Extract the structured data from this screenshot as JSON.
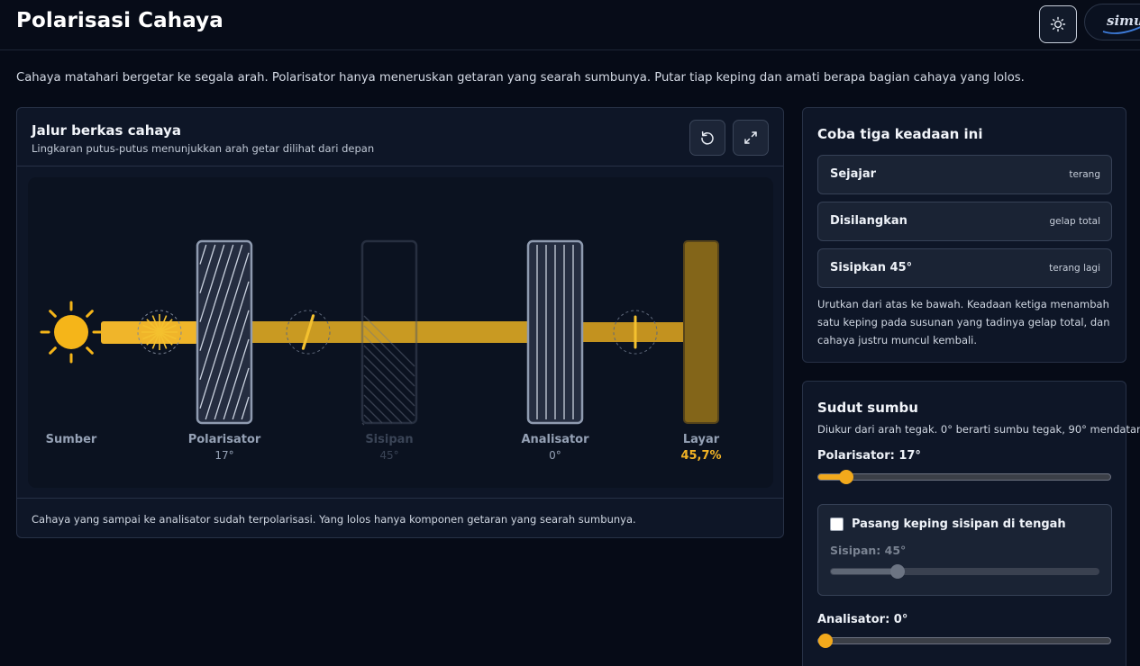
{
  "header": {
    "title": "Polarisasi Cahaya",
    "brand": "simu",
    "theme_icon": "sun-icon"
  },
  "intro": "Cahaya matahari bergetar ke segala arah. Polarisator hanya meneruskan getaran yang searah sumbunya. Putar tiap keping dan amati berapa bagian cahaya yang lolos.",
  "beam_panel": {
    "title": "Jalur berkas cahaya",
    "subtitle": "Lingkaran putus-putus menunjukkan arah getar dilihat dari depan",
    "reset_icon": "reset-icon",
    "expand_icon": "expand-icon",
    "components": {
      "source": {
        "label": "Sumber"
      },
      "polarizer": {
        "label": "Polarisator",
        "value": "17°",
        "angle": 17
      },
      "insert": {
        "label": "Sisipan",
        "value": "45°",
        "angle": 45,
        "enabled": false
      },
      "analyzer": {
        "label": "Analisator",
        "value": "0°",
        "angle": 0
      },
      "screen": {
        "label": "Layar",
        "value": "45,7%",
        "intensity": 0.457
      }
    },
    "footer": "Cahaya yang sampai ke analisator sudah terpolarisasi. Yang lolos hanya komponen getaran yang searah sumbunya."
  },
  "presets": {
    "title": "Coba tiga keadaan ini",
    "items": [
      {
        "name": "Sejajar",
        "tag": "terang"
      },
      {
        "name": "Disilangkan",
        "tag": "gelap total"
      },
      {
        "name": "Sisipkan 45°",
        "tag": "terang lagi"
      }
    ],
    "note": "Urutkan dari atas ke bawah. Keadaan ketiga menambah satu keping pada susunan yang tadinya gelap total, dan cahaya justru muncul kembali."
  },
  "angles": {
    "title": "Sudut sumbu",
    "subtitle": "Diukur dari arah tegak. 0° berarti sumbu tegak, 90° mendatar.",
    "polarizer_label": "Polarisator: 17°",
    "polarizer_value": 17,
    "insert_checkbox_label": "Pasang keping sisipan di tengah",
    "insert_checked": false,
    "insert_label": "Sisipan: 45°",
    "insert_value": 45,
    "analyzer_label": "Analisator: 0°",
    "analyzer_value": 0,
    "slider_max": 180
  },
  "colors": {
    "beam": "#f0b52a",
    "beam_dim": "#c3921f",
    "screen": "#836519",
    "accent": "#f2a91c",
    "background": "#060b17"
  }
}
